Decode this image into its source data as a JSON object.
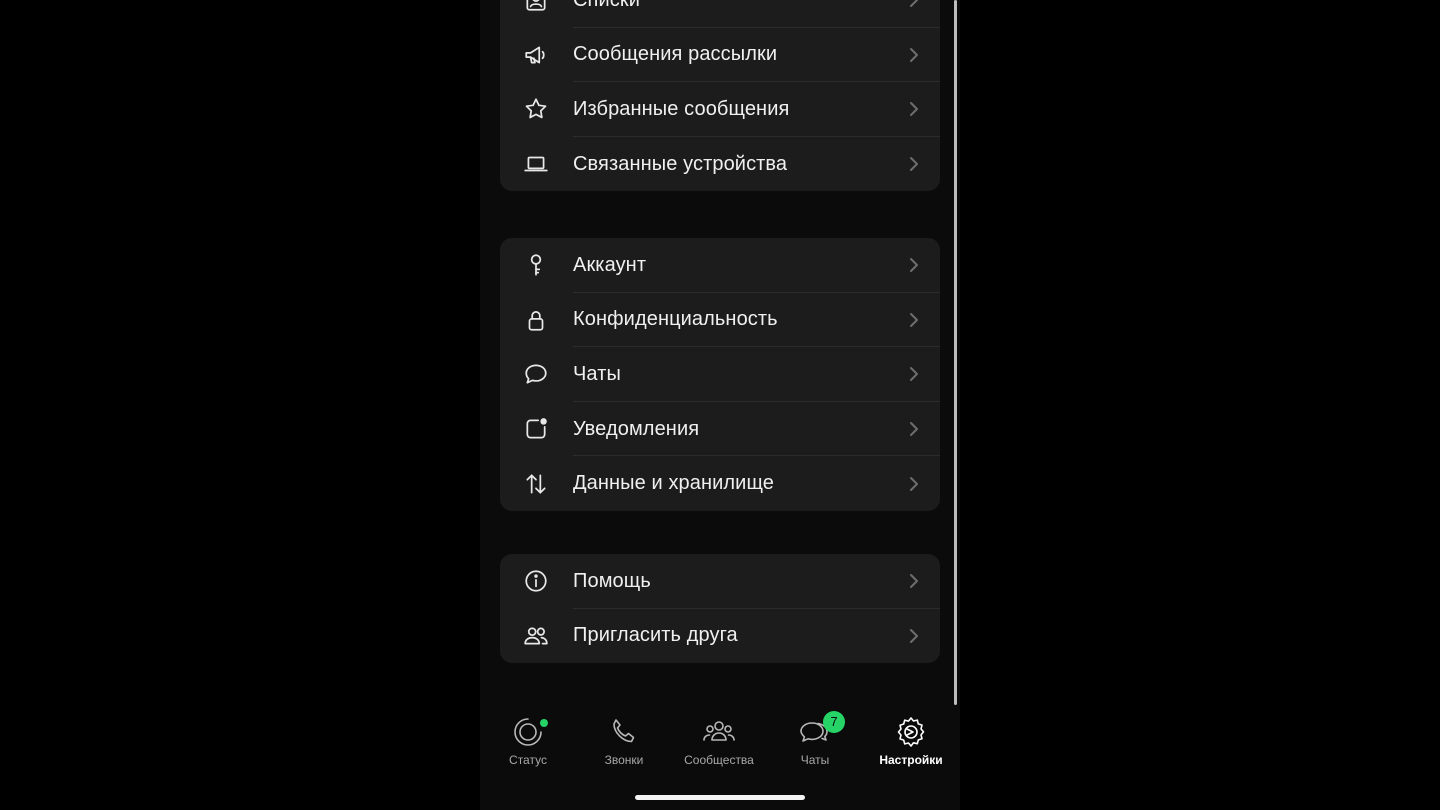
{
  "groups": [
    {
      "items": [
        {
          "label": "Списки",
          "icon": "contact-card-icon"
        },
        {
          "label": "Сообщения рассылки",
          "icon": "megaphone-icon"
        },
        {
          "label": "Избранные сообщения",
          "icon": "star-icon"
        },
        {
          "label": "Связанные устройства",
          "icon": "laptop-icon"
        }
      ]
    },
    {
      "items": [
        {
          "label": "Аккаунт",
          "icon": "key-icon"
        },
        {
          "label": "Конфиденциальность",
          "icon": "lock-icon"
        },
        {
          "label": "Чаты",
          "icon": "chat-bubble-icon"
        },
        {
          "label": "Уведомления",
          "icon": "notification-icon"
        },
        {
          "label": "Данные и хранилище",
          "icon": "transfer-arrows-icon"
        }
      ]
    },
    {
      "items": [
        {
          "label": "Помощь",
          "icon": "info-icon"
        },
        {
          "label": "Пригласить друга",
          "icon": "people-icon"
        }
      ]
    }
  ],
  "tabbar": {
    "tabs": [
      {
        "label": "Статус",
        "icon": "status-icon"
      },
      {
        "label": "Звонки",
        "icon": "phone-icon"
      },
      {
        "label": "Сообщества",
        "icon": "communities-icon"
      },
      {
        "label": "Чаты",
        "icon": "chats-icon",
        "badge": "7"
      },
      {
        "label": "Настройки",
        "icon": "settings-icon",
        "active": true
      }
    ]
  },
  "colors": {
    "accent": "#25d366",
    "background": "#000000",
    "group_background": "#1c1c1c"
  }
}
